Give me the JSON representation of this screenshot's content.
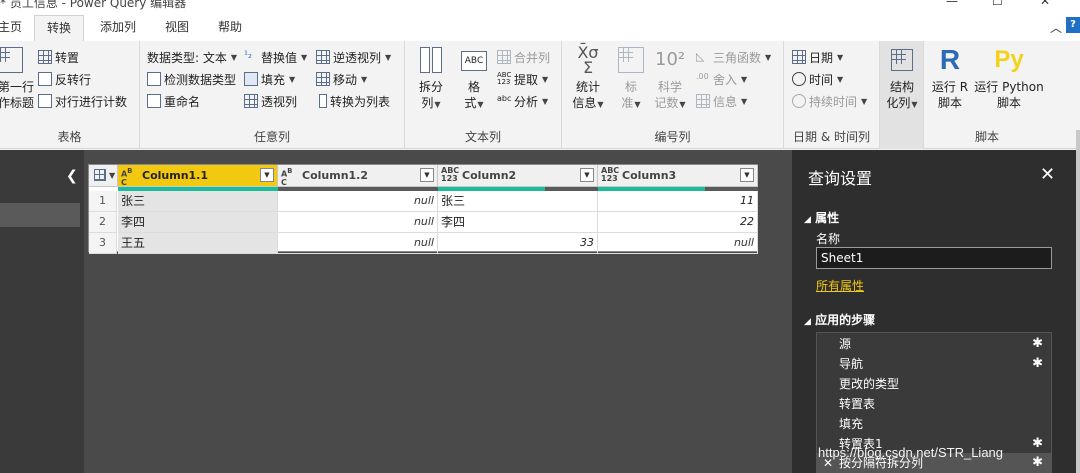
{
  "window": {
    "title": "* 员工信息 - Power Query 编辑器"
  },
  "tabs": [
    "主页",
    "转换",
    "添加列",
    "视图",
    "帮助"
  ],
  "ribbon": {
    "table": {
      "label": "表格",
      "first_row_header": "将第一行\n用作标题",
      "transpose": "转置",
      "reverse_rows": "反转行",
      "count_rows": "对行进行计数"
    },
    "any_column": {
      "label": "任意列",
      "data_type": "数据类型: 文本",
      "detect_type": "检测数据类型",
      "rename": "重命名",
      "replace_values": "替换值",
      "fill": "填充",
      "pivot": "透视列",
      "unpivot": "逆透视列",
      "move": "移动",
      "to_list": "转换为列表"
    },
    "text_column": {
      "label": "文本列",
      "split": "拆分\n列",
      "format": "格\n式",
      "merge": "合并列",
      "extract": "提取",
      "parse": "分析"
    },
    "number_column": {
      "label": "编号列",
      "stats": "统计\n信息",
      "standard": "标\n准",
      "scientific": "科学\n记数",
      "trig": "三角函数",
      "rounding": "舍入",
      "information": "信息"
    },
    "datetime_column": {
      "label": "日期 & 时间列",
      "date": "日期",
      "time": "时间",
      "duration": "持续时间"
    },
    "structured": {
      "label": "",
      "structured_col": "结构\n化列"
    },
    "scripts": {
      "label": "脚本",
      "run_r": "运行 R\n脚本",
      "run_python": "运行 Python\n脚本"
    }
  },
  "grid": {
    "columns": [
      {
        "type": "ABC",
        "name": "Column1.1"
      },
      {
        "type": "ABC",
        "name": "Column1.2"
      },
      {
        "type": "ABC123",
        "name": "Column2"
      },
      {
        "type": "ABC123",
        "name": "Column3"
      }
    ],
    "rows": [
      {
        "n": "1",
        "c1": "张三",
        "c2": "null",
        "c3": "张三",
        "c4": "11"
      },
      {
        "n": "2",
        "c1": "李四",
        "c2": "null",
        "c3": "李四",
        "c4": "22"
      },
      {
        "n": "3",
        "c1": "王五",
        "c2": "null",
        "c3": "33",
        "c4": "null"
      }
    ]
  },
  "query_settings": {
    "title": "查询设置",
    "properties_header": "属性",
    "name_label": "名称",
    "name_value": "Sheet1",
    "all_properties_link": "所有属性",
    "applied_steps_header": "应用的步骤",
    "steps": [
      {
        "label": "源",
        "gear": true
      },
      {
        "label": "导航",
        "gear": true
      },
      {
        "label": "更改的类型",
        "gear": false
      },
      {
        "label": "转置表",
        "gear": false
      },
      {
        "label": "填充",
        "gear": false
      },
      {
        "label": "转置表1",
        "gear": true
      },
      {
        "label": "按分隔符拆分列",
        "gear": true
      }
    ]
  },
  "watermark": "https://blog.csdn.net/STR_Liang",
  "colors": {
    "accent": "#f2c811",
    "quality_bar": "#1abc9c",
    "pane_bg": "#2e2e2e"
  }
}
